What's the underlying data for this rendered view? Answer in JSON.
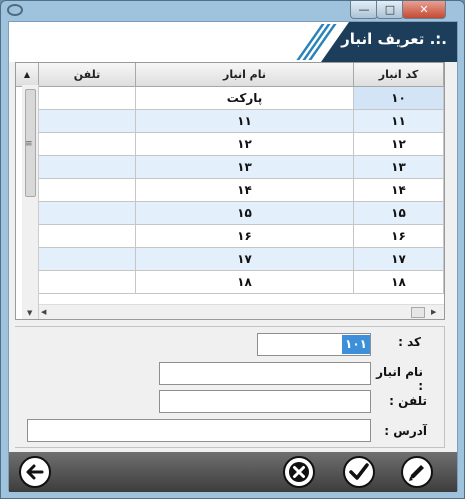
{
  "window": {
    "title": ".:. تعریف انبار"
  },
  "grid": {
    "columns": [
      "کد انبار",
      "نام انبار",
      "تلفن"
    ],
    "rows": [
      {
        "code": "۱۰",
        "name": "پارکت",
        "phone": ""
      },
      {
        "code": "۱۱",
        "name": "۱۱",
        "phone": ""
      },
      {
        "code": "۱۲",
        "name": "۱۲",
        "phone": ""
      },
      {
        "code": "۱۳",
        "name": "۱۳",
        "phone": ""
      },
      {
        "code": "۱۴",
        "name": "۱۴",
        "phone": ""
      },
      {
        "code": "۱۵",
        "name": "۱۵",
        "phone": ""
      },
      {
        "code": "۱۶",
        "name": "۱۶",
        "phone": ""
      },
      {
        "code": "۱۷",
        "name": "۱۷",
        "phone": ""
      },
      {
        "code": "۱۸",
        "name": "۱۸",
        "phone": ""
      }
    ],
    "selected_row_index": 0
  },
  "form": {
    "code_label": "کد :",
    "code_value": "۱۰۱",
    "name_label": "نام انبار :",
    "name_value": "",
    "phone_label": "تلفن :",
    "phone_value": "",
    "address_label": "آدرس :",
    "address_value": ""
  },
  "icons": {
    "back": "arrow-left-icon",
    "cancel": "x-circle-icon",
    "confirm": "checkmark-icon",
    "edit": "pencil-icon"
  },
  "colors": {
    "banner": "#1d3e5a",
    "selected_cell": "#3c8fd8",
    "alt_row": "#e3f0fb",
    "button_bar": "#4a4a4a"
  }
}
